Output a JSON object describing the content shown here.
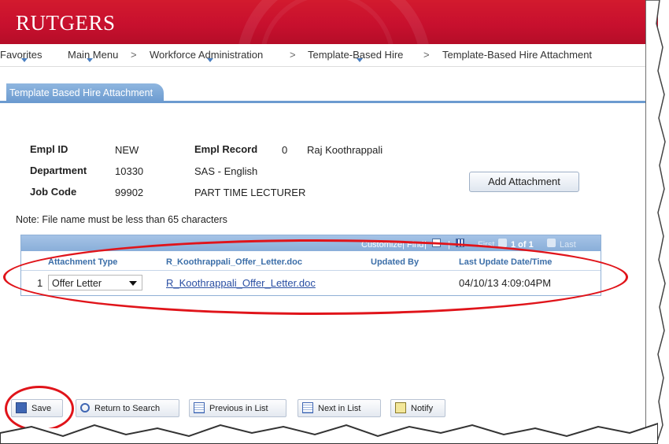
{
  "brand": {
    "logo": "RUTGERS"
  },
  "breadcrumb": {
    "items": [
      "Favorites",
      "Main Menu",
      "Workforce Administration",
      "Template-Based Hire",
      "Template-Based Hire Attachment"
    ],
    "separator": ">"
  },
  "tab": {
    "label": "Template Based Hire Attachment"
  },
  "employee": {
    "empl_id_label": "Empl ID",
    "empl_id": "NEW",
    "empl_record_label": "Empl Record",
    "empl_record": "0",
    "name": "Raj Koothrappali",
    "department_label": "Department",
    "department_code": "10330",
    "department_name": "SAS - English",
    "job_code_label": "Job Code",
    "job_code": "99902",
    "job_title": "PART TIME LECTURER"
  },
  "actions": {
    "add_attachment": "Add Attachment"
  },
  "note": "Note: File name must be less than 65 characters",
  "grid": {
    "nav": {
      "customize": "Customize",
      "find": "Find",
      "first": "First",
      "range": "1 of 1",
      "last": "Last"
    },
    "columns": [
      "Attachment Type",
      "R_Koothrappali_Offer_Letter.doc",
      "Updated By",
      "Last Update Date/Time"
    ],
    "rows": [
      {
        "num": "1",
        "type": "Offer Letter",
        "file": "R_Koothrappali_Offer_Letter.doc",
        "updated_by": "",
        "updated_at": "04/10/13  4:09:04PM"
      }
    ]
  },
  "toolbar": {
    "save": "Save",
    "return_to_search": "Return to Search",
    "previous_in_list": "Previous in List",
    "next_in_list": "Next in List",
    "notify": "Notify"
  },
  "colors": {
    "brand_red": "#c8102e",
    "tab_blue": "#6c9bd0",
    "annotation_red": "#e0141a",
    "link_blue": "#2a4fa3"
  }
}
